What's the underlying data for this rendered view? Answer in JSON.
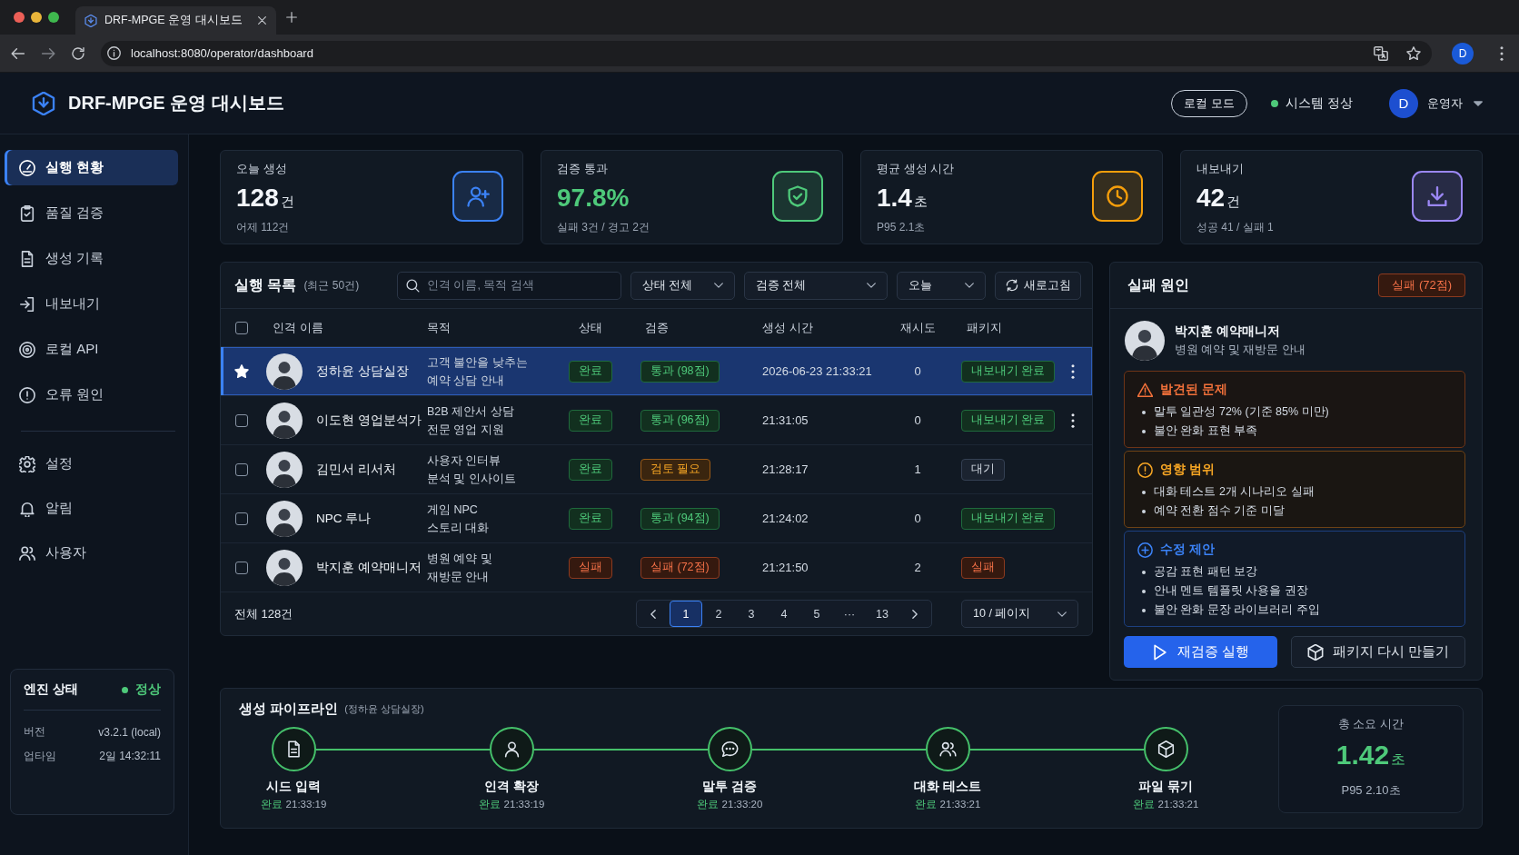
{
  "browser": {
    "tab_title": "DRF-MPGE 운영 대시보드",
    "url": "localhost:8080/operator/dashboard",
    "profile_initial": "D"
  },
  "header": {
    "title": "DRF-MPGE 운영 대시보드",
    "mode_button": "로컬 모드",
    "system_status": {
      "label": "시스템 정상",
      "ok": true
    },
    "user": {
      "initial": "D",
      "name": "운영자"
    }
  },
  "sidebar": {
    "items": [
      {
        "label": "실행 현황",
        "selected": true
      },
      {
        "label": "품질 검증",
        "selected": false
      },
      {
        "label": "생성 기록",
        "selected": false
      },
      {
        "label": "내보내기",
        "selected": false
      },
      {
        "label": "로컬 API",
        "selected": false
      },
      {
        "label": "오류 원인",
        "selected": false
      }
    ],
    "secondary_items": [
      {
        "label": "설정",
        "selected": false
      },
      {
        "label": "알림",
        "selected": false
      },
      {
        "label": "사용자",
        "selected": false
      }
    ],
    "engine": {
      "title": "엔진 상태",
      "status": "정상",
      "ok": true,
      "rows": [
        {
          "label": "버전",
          "value": "v3.2.1 (local)"
        },
        {
          "label": "업타임",
          "value": "2일 14:32:11"
        }
      ]
    }
  },
  "stats": [
    {
      "label": "오늘 생성",
      "value": "128",
      "unit": "건",
      "sub": "어제 112건",
      "color": "#3b82f6",
      "accent_value": false
    },
    {
      "label": "검증 통과",
      "value": "97.8%",
      "sub": "실패 3건 / 경고 2건",
      "color": "#4ec97a",
      "accent_value": true
    },
    {
      "label": "평균 생성 시간",
      "value": "1.4",
      "unit": "초",
      "sub": "P95 2.1초",
      "color": "#f59e0b",
      "accent_value": false
    },
    {
      "label": "내보내기",
      "value": "42",
      "unit": "건",
      "sub": "성공 41 / 실패 1",
      "color": "#9b87f5",
      "accent_value": false
    }
  ],
  "runs": {
    "title": "실행 목록",
    "subtitle": "(최근 50건)",
    "search": {
      "placeholder": "인격 이름, 목적 검색"
    },
    "filters": [
      "상태 전체",
      "검증 전체",
      "오늘"
    ],
    "refresh": "새로고침",
    "select_all_checked": false,
    "columns": [
      "인격 이름",
      "목적",
      "상태",
      "검증",
      "생성 시간",
      "재시도",
      "패키지"
    ],
    "rows": [
      {
        "name": "정하윤 상담실장",
        "purpose": [
          "고객 불안을 낮추는",
          "예약 상담 안내"
        ],
        "status": {
          "text": "완료",
          "kind": "success"
        },
        "verify": {
          "text": "통과 (98점)",
          "kind": "success"
        },
        "time": "2026-06-23 21:33:21",
        "retries": "0",
        "package": {
          "text": "내보내기 완료",
          "kind": "success"
        },
        "selected": true,
        "starred": true,
        "menu_button": true
      },
      {
        "name": "이도현 영업분석가",
        "purpose": [
          "B2B 제안서 상담",
          "전문 영업 지원"
        ],
        "status": {
          "text": "완료",
          "kind": "success"
        },
        "verify": {
          "text": "통과 (96점)",
          "kind": "success"
        },
        "time": "21:31:05",
        "retries": "0",
        "package": {
          "text": "내보내기 완료",
          "kind": "success"
        },
        "selected": false,
        "starred": false,
        "checked": false,
        "menu_button": true
      },
      {
        "name": "김민서 리서처",
        "purpose": [
          "사용자 인터뷰",
          "분석 및 인사이트"
        ],
        "status": {
          "text": "완료",
          "kind": "success"
        },
        "verify": {
          "text": "검토 필요",
          "kind": "warning"
        },
        "time": "21:28:17",
        "retries": "1",
        "package": {
          "text": "대기",
          "kind": "neutral"
        },
        "selected": false,
        "starred": false,
        "checked": false,
        "menu_button": false
      },
      {
        "name": "NPC 루나",
        "purpose": [
          "게임 NPC",
          "스토리 대화"
        ],
        "status": {
          "text": "완료",
          "kind": "success"
        },
        "verify": {
          "text": "통과 (94점)",
          "kind": "success"
        },
        "time": "21:24:02",
        "retries": "0",
        "package": {
          "text": "내보내기 완료",
          "kind": "success"
        },
        "selected": false,
        "starred": false,
        "checked": false,
        "menu_button": false
      },
      {
        "name": "박지훈 예약매니저",
        "purpose": [
          "병원 예약 및",
          "재방문 안내"
        ],
        "status": {
          "text": "실패",
          "kind": "danger"
        },
        "verify": {
          "text": "실패 (72점)",
          "kind": "danger"
        },
        "time": "21:21:50",
        "retries": "2",
        "package": {
          "text": "실패",
          "kind": "danger"
        },
        "selected": false,
        "starred": false,
        "checked": false,
        "menu_button": false
      }
    ],
    "total": "전체 128건",
    "pages": [
      {
        "label": "1",
        "selected": true
      },
      {
        "label": "2",
        "selected": false
      },
      {
        "label": "3",
        "selected": false
      },
      {
        "label": "4",
        "selected": false
      },
      {
        "label": "5",
        "selected": false
      },
      {
        "label": "···",
        "selected": false
      },
      {
        "label": "13",
        "selected": false
      }
    ],
    "page_size": "10 / 페이지"
  },
  "failure": {
    "title": "실패 원인",
    "badge": {
      "text": "실패 (72점)",
      "kind": "danger"
    },
    "persona": {
      "name": "박지훈 예약매니저",
      "purpose": "병원 예약 및 재방문 안내"
    },
    "sections": [
      {
        "kind": "problem",
        "title": "발견된 문제",
        "items": [
          "말투 일관성 72% (기준 85% 미만)",
          "불안 완화 표현 부족"
        ]
      },
      {
        "kind": "impact",
        "title": "영향 범위",
        "items": [
          "대화 테스트 2개 시나리오 실패",
          "예약 전환 점수 기준 미달"
        ]
      },
      {
        "kind": "suggestion",
        "title": "수정 제안",
        "items": [
          "공감 표현 패턴 보강",
          "안내 멘트 템플릿 사용을 권장",
          "불안 완화 문장 라이브러리 주입"
        ]
      }
    ],
    "actions": [
      {
        "label": "재검증 실행",
        "kind": "primary"
      },
      {
        "label": "패키지 다시 만들기",
        "kind": "secondary"
      }
    ]
  },
  "pipeline": {
    "title": "생성 파이프라인",
    "subtitle": "(정하윤 상담실장)",
    "steps": [
      {
        "label": "시드 입력",
        "status": "완료",
        "time": "21:33:19",
        "done": true
      },
      {
        "label": "인격 확장",
        "status": "완료",
        "time": "21:33:19",
        "done": true
      },
      {
        "label": "말투 검증",
        "status": "완료",
        "time": "21:33:20",
        "done": true
      },
      {
        "label": "대화 테스트",
        "status": "완료",
        "time": "21:33:21",
        "done": true
      },
      {
        "label": "파일 묶기",
        "status": "완료",
        "time": "21:33:21",
        "done": true
      }
    ],
    "total": {
      "label": "총 소요 시간",
      "value": "1.42",
      "unit": "초",
      "p95": "P95 2.10초"
    }
  }
}
